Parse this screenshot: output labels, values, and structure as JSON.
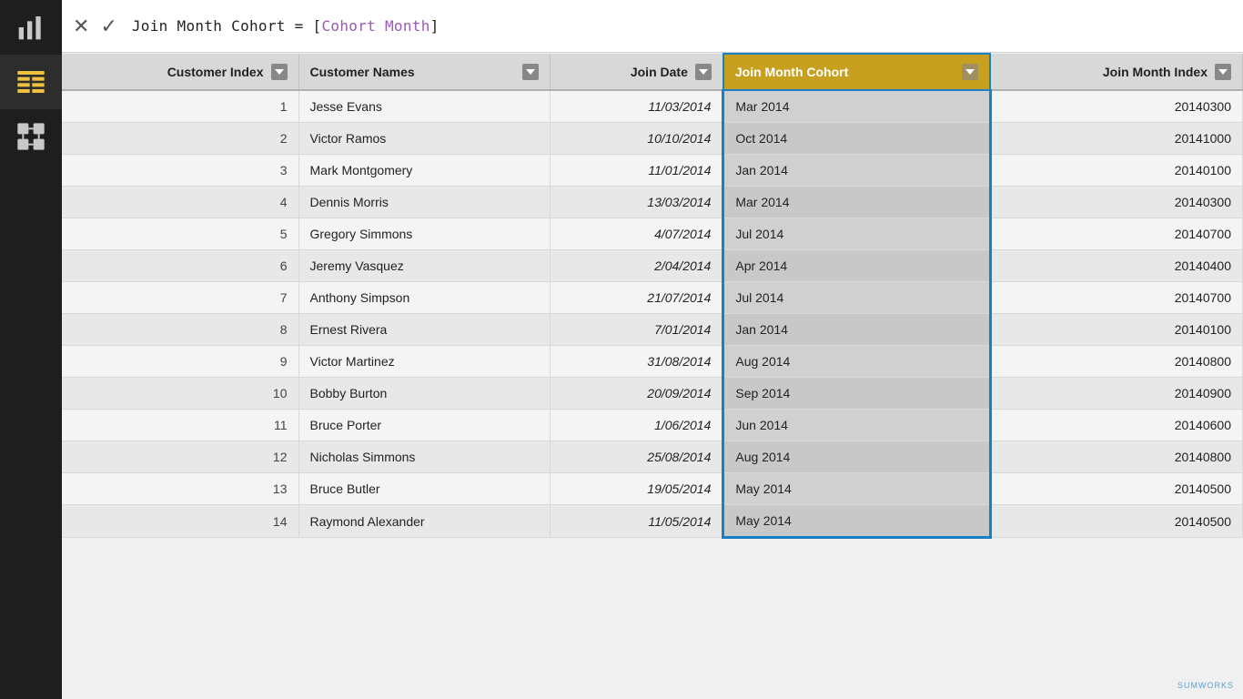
{
  "formula_bar": {
    "cancel_label": "✕",
    "confirm_label": "✓",
    "formula_text": "Join Month Cohort = [Cohort Month]",
    "formula_plain": "Join Month Cohort = [",
    "formula_highlight": "Cohort Month",
    "formula_close": "]"
  },
  "columns": [
    {
      "id": "customer-index",
      "label": "Customer Index",
      "align": "right"
    },
    {
      "id": "customer-names",
      "label": "Customer Names",
      "align": "left"
    },
    {
      "id": "join-date",
      "label": "Join Date",
      "align": "right"
    },
    {
      "id": "join-month-cohort",
      "label": "Join Month Cohort",
      "align": "left",
      "highlighted": true
    },
    {
      "id": "join-month-index",
      "label": "Join Month Index",
      "align": "right"
    }
  ],
  "rows": [
    {
      "index": 1,
      "name": "Jesse Evans",
      "join_date": "11/03/2014",
      "cohort": "Mar 2014",
      "cohort_index": "20140300"
    },
    {
      "index": 2,
      "name": "Victor Ramos",
      "join_date": "10/10/2014",
      "cohort": "Oct 2014",
      "cohort_index": "20141000"
    },
    {
      "index": 3,
      "name": "Mark Montgomery",
      "join_date": "11/01/2014",
      "cohort": "Jan 2014",
      "cohort_index": "20140100"
    },
    {
      "index": 4,
      "name": "Dennis Morris",
      "join_date": "13/03/2014",
      "cohort": "Mar 2014",
      "cohort_index": "20140300"
    },
    {
      "index": 5,
      "name": "Gregory Simmons",
      "join_date": "4/07/2014",
      "cohort": "Jul 2014",
      "cohort_index": "20140700"
    },
    {
      "index": 6,
      "name": "Jeremy Vasquez",
      "join_date": "2/04/2014",
      "cohort": "Apr 2014",
      "cohort_index": "20140400"
    },
    {
      "index": 7,
      "name": "Anthony Simpson",
      "join_date": "21/07/2014",
      "cohort": "Jul 2014",
      "cohort_index": "20140700"
    },
    {
      "index": 8,
      "name": "Ernest Rivera",
      "join_date": "7/01/2014",
      "cohort": "Jan 2014",
      "cohort_index": "20140100"
    },
    {
      "index": 9,
      "name": "Victor Martinez",
      "join_date": "31/08/2014",
      "cohort": "Aug 2014",
      "cohort_index": "20140800"
    },
    {
      "index": 10,
      "name": "Bobby Burton",
      "join_date": "20/09/2014",
      "cohort": "Sep 2014",
      "cohort_index": "20140900"
    },
    {
      "index": 11,
      "name": "Bruce Porter",
      "join_date": "1/06/2014",
      "cohort": "Jun 2014",
      "cohort_index": "20140600"
    },
    {
      "index": 12,
      "name": "Nicholas Simmons",
      "join_date": "25/08/2014",
      "cohort": "Aug 2014",
      "cohort_index": "20140800"
    },
    {
      "index": 13,
      "name": "Bruce Butler",
      "join_date": "19/05/2014",
      "cohort": "May 2014",
      "cohort_index": "20140500"
    },
    {
      "index": 14,
      "name": "Raymond Alexander",
      "join_date": "11/05/2014",
      "cohort": "May 2014",
      "cohort_index": "20140500"
    }
  ],
  "sidebar": {
    "icons": [
      "bar-chart-icon",
      "table-icon",
      "relationship-icon"
    ]
  },
  "watermark": "SUMWORKS"
}
